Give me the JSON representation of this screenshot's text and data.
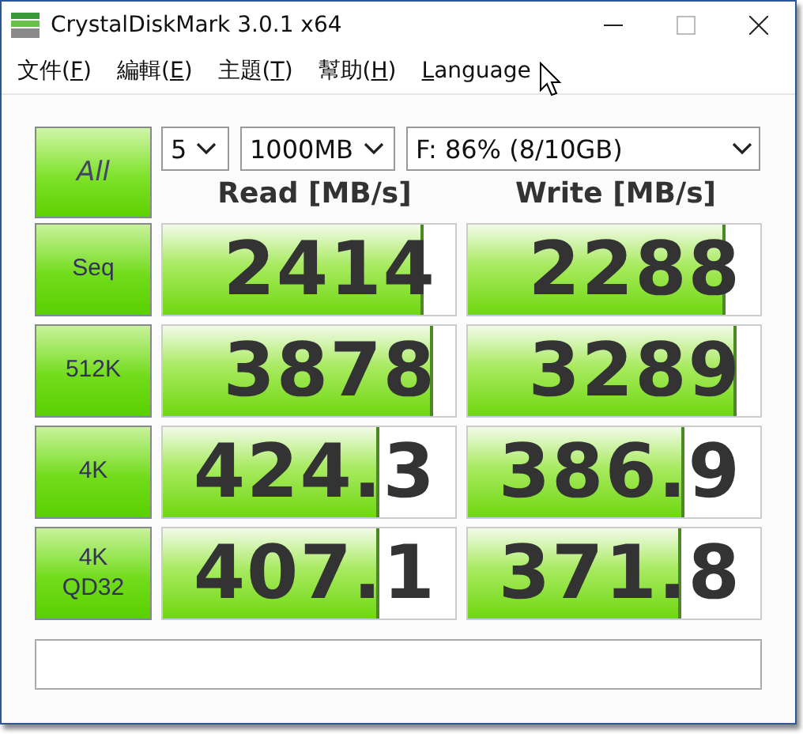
{
  "window": {
    "title": "CrystalDiskMark 3.0.1 x64"
  },
  "menu": [
    {
      "before": "文件(",
      "access_key": "F",
      "after": ")"
    },
    {
      "before": "編輯(",
      "access_key": "E",
      "after": ")"
    },
    {
      "before": "主題(",
      "access_key": "T",
      "after": ")"
    },
    {
      "before": "幫助(",
      "access_key": "H",
      "after": ")"
    },
    {
      "access_key": "L",
      "after": "anguage"
    }
  ],
  "all_button": {
    "label": "All"
  },
  "settings": {
    "count": "5",
    "size": "1000MB",
    "drive": "F: 86% (8/10GB)"
  },
  "columns": [
    "Read [MB/s]",
    "Write [MB/s]"
  ],
  "rows": [
    {
      "label": "Seq",
      "read": {
        "value": "2414",
        "level": 0.88
      },
      "write": {
        "value": "2288",
        "level": 0.87
      }
    },
    {
      "label": "512K",
      "read": {
        "value": "3878",
        "level": 0.915
      },
      "write": {
        "value": "3289",
        "level": 0.91
      }
    },
    {
      "label": "4K",
      "read": {
        "value": "424.3",
        "level": 0.73
      },
      "write": {
        "value": "386.9",
        "level": 0.73
      }
    },
    {
      "label": "4K\nQD32",
      "read": {
        "value": "407.1",
        "level": 0.73
      },
      "write": {
        "value": "371.8",
        "level": 0.72
      }
    }
  ]
}
